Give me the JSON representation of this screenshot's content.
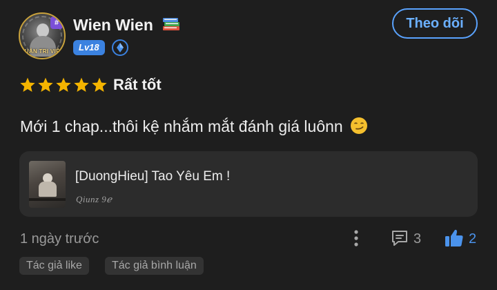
{
  "user": {
    "name": "Wien Wien",
    "level": "Lv18",
    "avatar_frame_text": "QUẢN TRỊ VIÊN",
    "avatar_badge": "#"
  },
  "follow_button": {
    "label": "Theo dõi"
  },
  "rating": {
    "stars": 5,
    "max_stars": 5,
    "label": "Rất tốt"
  },
  "comment": {
    "text": "Mới 1 chap...thôi kệ nhắm mắt đánh giá luônn"
  },
  "work": {
    "title": "[DuongHieu] Tao Yêu Em !",
    "author_signature": "Qiunz 9ℯ"
  },
  "footer": {
    "timestamp": "1 ngày trước",
    "comment_count": "3",
    "like_count": "2"
  },
  "tags": [
    "Tác giả like",
    "Tác giả bình luận"
  ],
  "colors": {
    "background": "#1e1e1e",
    "accent_blue": "#4b93ec",
    "star_gold": "#f4b400",
    "card_bg": "#2c2c2c"
  }
}
